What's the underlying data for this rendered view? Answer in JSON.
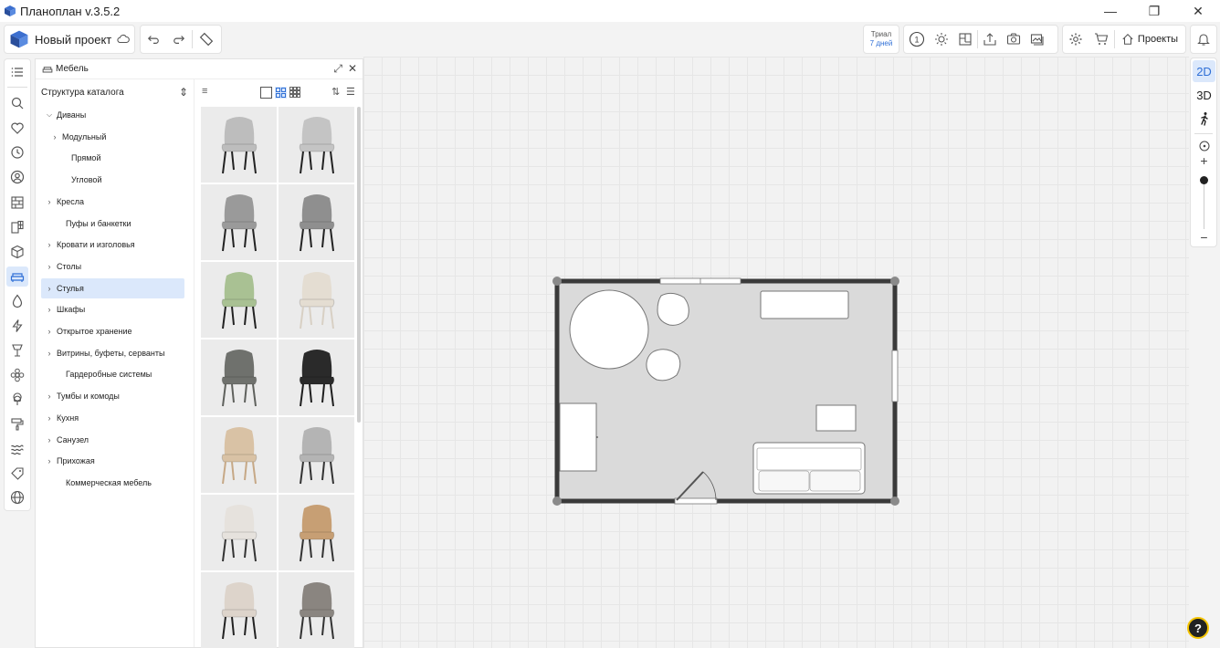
{
  "window": {
    "title": "Планоплан v.3.5.2"
  },
  "toolbar": {
    "project_name": "Новый проект",
    "trial_line1": "Триал",
    "trial_line2": "7 дней",
    "projects_label": "Проекты"
  },
  "panel": {
    "title": "Мебель",
    "tree_title": "Структура каталога",
    "tree": [
      {
        "label": "Диваны",
        "level": 0,
        "chevron": "down"
      },
      {
        "label": "Модульный",
        "level": 1,
        "chevron": "right"
      },
      {
        "label": "Прямой",
        "level": 1,
        "chevron": ""
      },
      {
        "label": "Угловой",
        "level": 1,
        "chevron": ""
      },
      {
        "label": "Кресла",
        "level": 0,
        "chevron": "right"
      },
      {
        "label": "Пуфы и банкетки",
        "level": 0,
        "chevron": ""
      },
      {
        "label": "Кровати и изголовья",
        "level": 0,
        "chevron": "right"
      },
      {
        "label": "Столы",
        "level": 0,
        "chevron": "right"
      },
      {
        "label": "Стулья",
        "level": 0,
        "chevron": "right",
        "selected": true
      },
      {
        "label": "Шкафы",
        "level": 0,
        "chevron": "right"
      },
      {
        "label": "Открытое хранение",
        "level": 0,
        "chevron": "right"
      },
      {
        "label": "Витрины, буфеты, серванты",
        "level": 0,
        "chevron": "right"
      },
      {
        "label": "Гардеробные системы",
        "level": 0,
        "chevron": ""
      },
      {
        "label": "Тумбы и комоды",
        "level": 0,
        "chevron": "right"
      },
      {
        "label": "Кухня",
        "level": 0,
        "chevron": "right"
      },
      {
        "label": "Санузел",
        "level": 0,
        "chevron": "right"
      },
      {
        "label": "Прихожая",
        "level": 0,
        "chevron": "right"
      },
      {
        "label": "Коммерческая мебель",
        "level": 0,
        "chevron": ""
      }
    ],
    "thumbnails": [
      {
        "name": "chair-grey-armchair",
        "seat": "#bdbdbd",
        "legs": "#222"
      },
      {
        "name": "chair-grey-dining",
        "seat": "#c4c4c4",
        "legs": "#222"
      },
      {
        "name": "chair-darkgrey-armchair",
        "seat": "#9a9a9a",
        "legs": "#222"
      },
      {
        "name": "barstool-grey",
        "seat": "#8f8f8f",
        "legs": "#222"
      },
      {
        "name": "chair-sage-green",
        "seat": "#a9c193",
        "legs": "#222"
      },
      {
        "name": "armchair-cream",
        "seat": "#e4ddd2",
        "legs": "#d8d0c4"
      },
      {
        "name": "chair-grey-sled",
        "seat": "#6f716d",
        "legs": "#5f615d"
      },
      {
        "name": "chair-black-frame",
        "seat": "#2a2a2a",
        "legs": "#1e1e1e"
      },
      {
        "name": "chair-wood-kids",
        "seat": "#d9c2a5",
        "legs": "#c6a886"
      },
      {
        "name": "chair-grey-shell",
        "seat": "#b4b4b4",
        "legs": "#333"
      },
      {
        "name": "chair-white-swivel",
        "seat": "#e6e2dd",
        "legs": "#333"
      },
      {
        "name": "chair-tan-leather",
        "seat": "#c79f74",
        "legs": "#333"
      },
      {
        "name": "chair-beige-tall",
        "seat": "#ddd4cb",
        "legs": "#222"
      },
      {
        "name": "chair-taupe",
        "seat": "#8a8580",
        "legs": "#333"
      }
    ]
  },
  "rightbar": {
    "mode_2d": "2D",
    "mode_3d": "3D"
  },
  "help": {
    "label": "?"
  },
  "colors": {
    "accent": "#2f6fd6",
    "selected_bg": "#dbe8fb",
    "wall": "#3a3a3a",
    "floor": "#dadada"
  }
}
